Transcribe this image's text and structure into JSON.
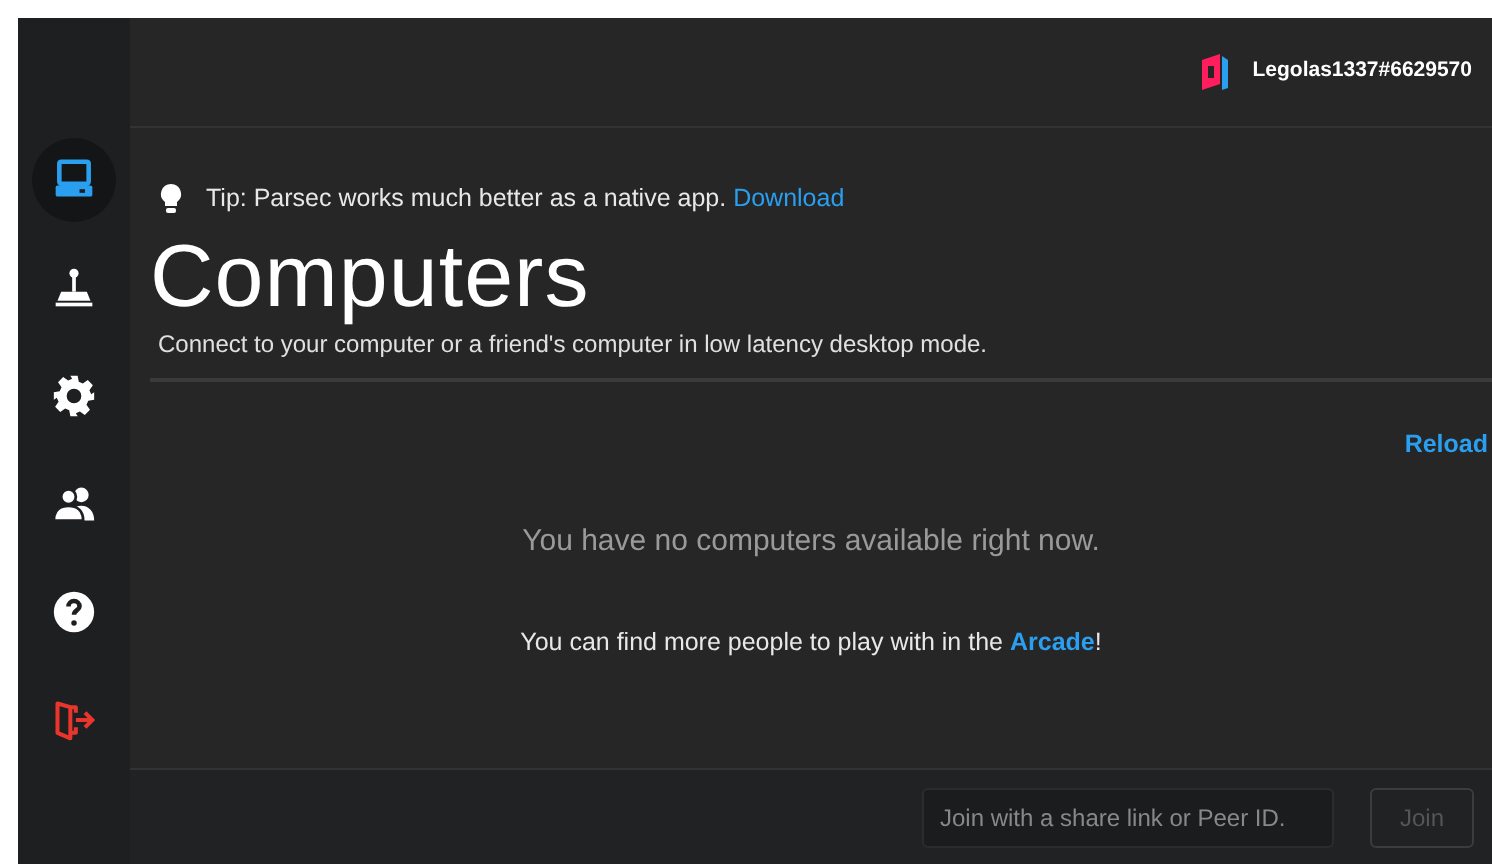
{
  "account": {
    "username": "Legolas1337#6629570"
  },
  "sidebar": {
    "items": [
      {
        "kind": "computers",
        "selected": true
      },
      {
        "kind": "arcade",
        "selected": false
      },
      {
        "kind": "settings",
        "selected": false
      },
      {
        "kind": "friends",
        "selected": false
      },
      {
        "kind": "help",
        "selected": false
      },
      {
        "kind": "logout",
        "selected": false
      }
    ]
  },
  "tip": {
    "text": "Tip: Parsec works much better as a native app.",
    "link": "Download"
  },
  "page": {
    "title": "Computers",
    "subtitle": "Connect to your computer or a friend's computer in low latency desktop mode.",
    "reload": "Reload",
    "empty_message": "You have no computers available right now.",
    "arcade_before": "You can find more people to play with in the",
    "arcade_link": "Arcade",
    "arcade_after": "!"
  },
  "join": {
    "placeholder": "Join with a share link or Peer ID.",
    "button": "Join",
    "button_disabled": true
  }
}
